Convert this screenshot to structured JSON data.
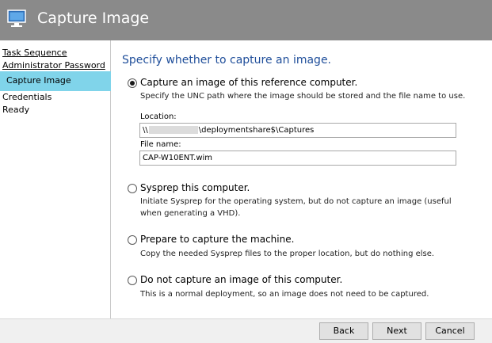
{
  "window": {
    "title": "Capture Image"
  },
  "sidebar": {
    "items": [
      {
        "label": "Task Sequence"
      },
      {
        "label": "Administrator Password"
      },
      {
        "label": "Capture Image"
      },
      {
        "label": "Credentials"
      },
      {
        "label": "Ready"
      }
    ]
  },
  "main": {
    "heading": "Specify whether to capture an image.",
    "options": [
      {
        "label": "Capture an image of this reference computer.",
        "selected": true,
        "description": "Specify the UNC path where the image should be stored and the file name to use."
      },
      {
        "label": "Sysprep this computer.",
        "selected": false,
        "description": "Initiate Sysprep for the operating system, but do not capture an image (useful when generating a VHD)."
      },
      {
        "label": "Prepare to capture the machine.",
        "selected": false,
        "description": "Copy the needed Sysprep files to the proper location, but do nothing else."
      },
      {
        "label": "Do not capture an image of this computer.",
        "selected": false,
        "description": "This is a normal deployment, so an image does not need to be captured."
      }
    ],
    "location": {
      "label": "Location:",
      "value_prefix": "\\\\",
      "value_suffix": "\\deploymentshare$\\Captures"
    },
    "filename": {
      "label": "File name:",
      "value": "CAP-W10ENT.wim"
    }
  },
  "footer": {
    "back_label": "Back",
    "next_label": "Next",
    "cancel_label": "Cancel"
  },
  "colors": {
    "titlebar": "#8a8a8a",
    "sidebar_selected": "#80d4ea",
    "heading": "#1f4e9a"
  }
}
